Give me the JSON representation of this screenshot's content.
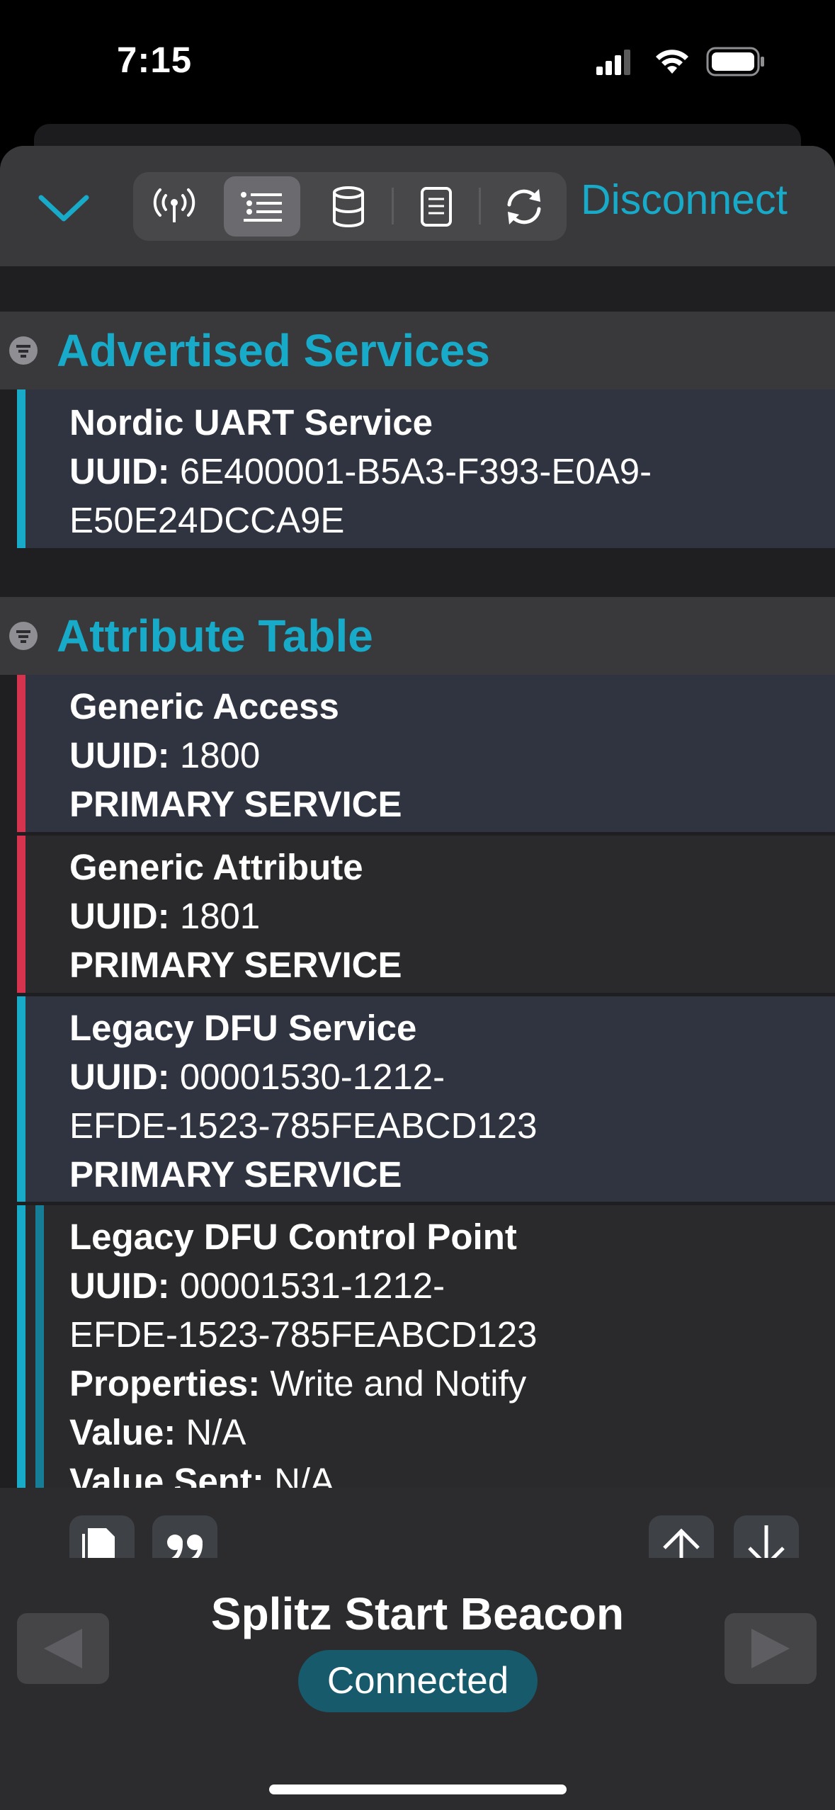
{
  "status_bar": {
    "time": "7:15"
  },
  "toolbar": {
    "collapse_icon": "chevron-down-icon",
    "segments": [
      {
        "icon": "antenna-icon",
        "active": false
      },
      {
        "icon": "list-icon",
        "active": true
      },
      {
        "icon": "database-icon",
        "active": false
      },
      {
        "icon": "document-icon",
        "active": false
      },
      {
        "icon": "refresh-icon",
        "active": false
      }
    ],
    "disconnect_label": "Disconnect"
  },
  "advertised_services": {
    "title": "Advertised Services",
    "items": [
      {
        "name": "Nordic UART Service",
        "uuid_label": "UUID:",
        "uuid_line1": " 6E400001-B5A3-F393-E0A9-",
        "uuid_line2": "E50E24DCCA9E"
      }
    ]
  },
  "attribute_table": {
    "title": "Attribute Table",
    "rows": [
      {
        "name": "Generic Access",
        "uuid_label": "UUID:",
        "uuid": " 1800",
        "type": "PRIMARY SERVICE",
        "color": "#d6334e"
      },
      {
        "name": "Generic Attribute",
        "uuid_label": "UUID:",
        "uuid": " 1801",
        "type": "PRIMARY SERVICE",
        "color": "#d6334e"
      },
      {
        "name": "Legacy DFU Service",
        "uuid_label": "UUID:",
        "uuid_line1": " 00001530-1212-",
        "uuid_line2": "EFDE-1523-785FEABCD123",
        "type": "PRIMARY SERVICE",
        "color": "#18aac9"
      },
      {
        "name": "Legacy DFU Control Point",
        "uuid_label": "UUID:",
        "uuid_line1": " 00001531-1212-",
        "uuid_line2": "EFDE-1523-785FEABCD123",
        "properties_label": "Properties:",
        "properties": " Write and Notify",
        "value_label": "Value:",
        "value": " N/A",
        "value_sent_label": "Value Sent:",
        "value_sent": " N/A",
        "color": "#18aac9"
      }
    ]
  },
  "row_actions": [
    "copy-icon",
    "quote-icon",
    "upload-icon",
    "download-icon"
  ],
  "footer": {
    "device_name": "Splitz Start Beacon",
    "connection_status": "Connected",
    "prev_icon": "triangle-left-icon",
    "next_icon": "triangle-right-icon"
  },
  "colors": {
    "accent": "#18aac9",
    "service_red": "#d6334e",
    "badge_bg": "#165a6b"
  }
}
